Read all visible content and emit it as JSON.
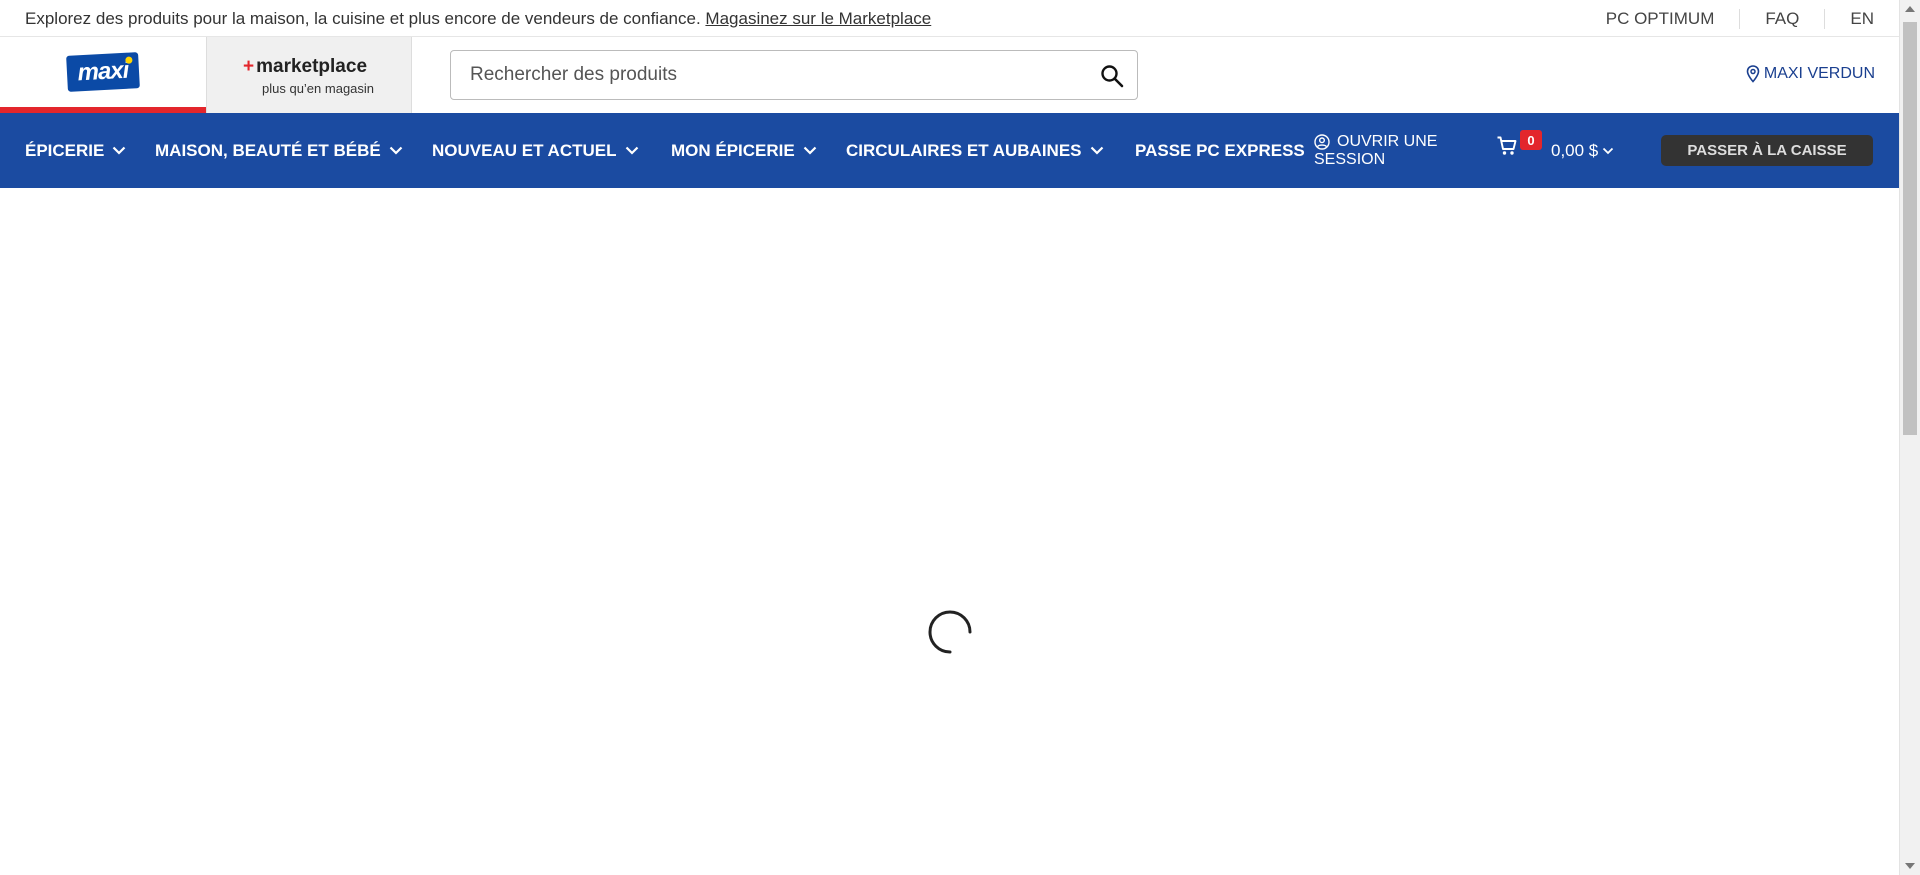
{
  "topbar": {
    "message": "Explorez des produits pour la maison, la cuisine et plus encore de vendeurs de confiance.",
    "link": "Magasinez sur le Marketplace",
    "utility_links": [
      "PC OPTIMUM",
      "FAQ",
      "EN"
    ]
  },
  "header": {
    "brand_logo": "maxi",
    "marketplace_title": "marketplace",
    "marketplace_plus": "+",
    "marketplace_subtitle": "plus qu’en magasin",
    "search_placeholder": "Rechercher des produits",
    "store_label": "MAXI VERDUN"
  },
  "nav": {
    "items": [
      {
        "label": "ÉPICERIE",
        "has_dropdown": true
      },
      {
        "label": "MAISON, BEAUTÉ ET BÉBÉ",
        "has_dropdown": true
      },
      {
        "label": "NOUVEAU ET ACTUEL",
        "has_dropdown": true
      },
      {
        "label": "MON ÉPICERIE",
        "has_dropdown": true
      },
      {
        "label": "CIRCULAIRES ET AUBAINES",
        "has_dropdown": true
      },
      {
        "label": "PASSE PC EXPRESS",
        "has_dropdown": false
      }
    ],
    "signin_line1": "OUVRIR UNE",
    "signin_line2": "SESSION",
    "cart_count": "0",
    "cart_total": "0,00 $",
    "checkout_label": "PASSER À LA CAISSE"
  },
  "colors": {
    "nav_blue": "#1b4ba1",
    "brand_red": "#e3262c",
    "checkout_bg": "#333333",
    "store_link": "#1a3f8f"
  },
  "icons": {
    "search": "search-icon",
    "store": "location-pin-icon",
    "account": "user-circle-icon",
    "cart": "cart-icon",
    "dropdown": "chevron-down-icon",
    "loading": "loading-spinner-icon"
  }
}
